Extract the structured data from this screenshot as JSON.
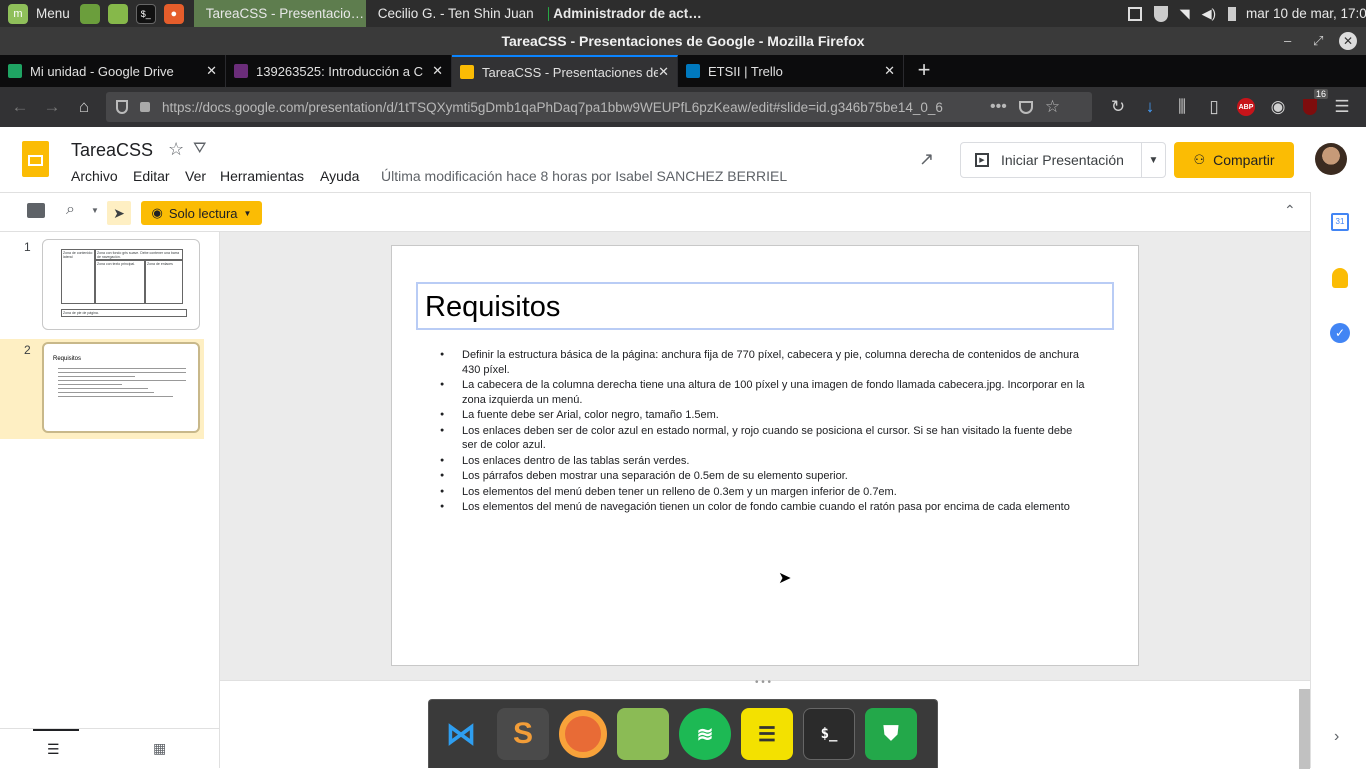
{
  "panel": {
    "menu_label": "Menu",
    "tasks": [
      {
        "label": "TareaCSS - Presentacio…",
        "active": true
      },
      {
        "label": "Cecilio G. - Ten Shin Juan",
        "active": false
      },
      {
        "label": "Administrador de act…",
        "active": false
      }
    ],
    "clock": "mar 10 de mar, 17:04"
  },
  "window": {
    "title": "TareaCSS - Presentaciones de Google - Mozilla Firefox"
  },
  "tabs": [
    {
      "label": "Mi unidad - Google Drive",
      "color": "#1fa463"
    },
    {
      "label": "139263525: Introducción a C",
      "color": "#6b2d7a"
    },
    {
      "label": "TareaCSS - Presentaciones de",
      "color": "#fbbc04"
    },
    {
      "label": "ETSII | Trello",
      "color": "#0079bf"
    }
  ],
  "nav": {
    "url": "https://docs.google.com/presentation/d/1tTSQXymti5gDmb1qaPhDaq7pa1bbw9WEUPfL6pzKeaw/edit#slide=id.g346b75be14_0_6",
    "ublock_badge": "16",
    "abp": "ABP"
  },
  "doc": {
    "title": "TareaCSS",
    "menus": [
      "Archivo",
      "Editar",
      "Ver",
      "Herramientas",
      "Ayuda"
    ],
    "last_modified": "Última modificación hace 8 horas por Isabel SANCHEZ BERRIEL",
    "present_label": "Iniciar Presentación",
    "share_label": "Compartir",
    "readonly_label": "Solo lectura"
  },
  "filmstrip": {
    "slides": [
      {
        "num": "1"
      },
      {
        "num": "2",
        "mini_title": "Requisitos"
      }
    ],
    "slide1_texts": [
      "Zona de contenido: lateral",
      "Zona con fondo gris suave. Debe contener una barra de navegación.",
      "Zona con texto principal.",
      "Zona de enlaces",
      "Zona de pie de página."
    ]
  },
  "slide": {
    "title": "Requisitos",
    "bullets": [
      "Definir la estructura básica de la página: anchura fija de 770 píxel,  cabecera y pie, columna derecha de contenidos de anchura 430 píxel.",
      " La cabecera de la columna derecha tiene una altura de 100 píxel y una imagen de fondo llamada cabecera.jpg. Incorporar en la zona izquierda un menú.",
      "La fuente debe ser Arial, color negro, tamaño 1.5em.",
      "Los enlaces deben ser de color azul en estado normal, y rojo cuando se posiciona el cursor. Si se han visitado la fuente debe ser de color azul.",
      "Los enlaces dentro de las tablas serán verdes.",
      "Los párrafos deben mostrar una separación de 0.5em de su elemento superior.",
      "Los elementos del menú deben tener un relleno de 0.3em y un margen inferior de 0.7em.",
      "Los elementos del menú de navegación tienen un color de fondo cambie cuando el ratón pasa por encima de cada elemento"
    ]
  },
  "sidepanel": {
    "calendar_day": "31"
  },
  "colors": {
    "accent": "#fbbc04",
    "firefox_blue": "#0a84ff"
  }
}
